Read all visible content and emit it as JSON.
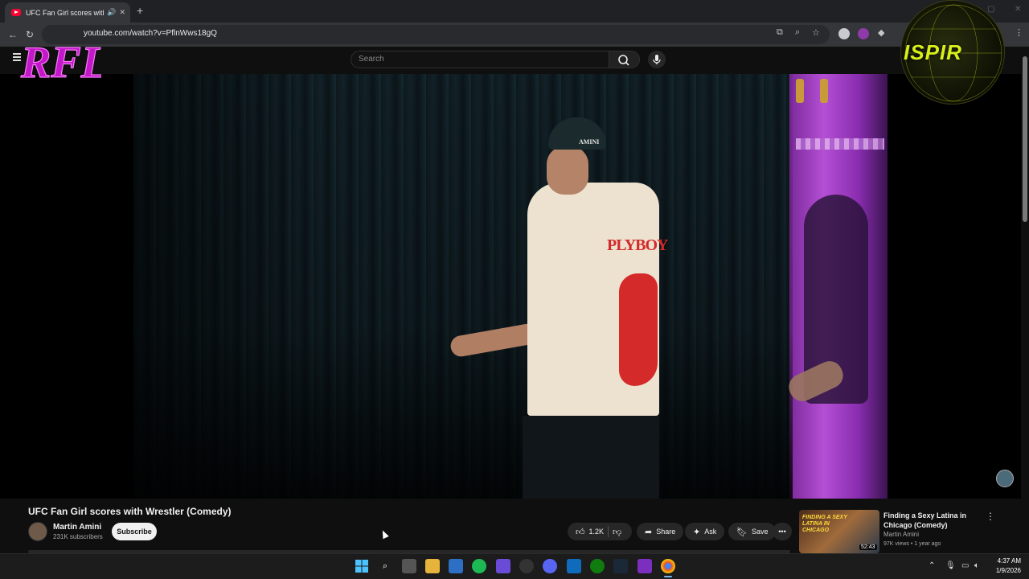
{
  "browser": {
    "tab_title": "UFC Fan Girl scores with Wrestler (Comedy)",
    "tab_audio_icon": "speaker-icon",
    "new_tab_label": "+",
    "url": "youtube.com/watch?v=PflnWws18gQ"
  },
  "youtube": {
    "search_placeholder": "Search",
    "video": {
      "cap_text": "AMINI",
      "shirt_text": "PLYBOY"
    },
    "title": "UFC Fan Girl scores with Wrestler (Comedy)",
    "channel": {
      "name": "Martin Amini",
      "subscribers": "231K subscribers",
      "subscribe_label": "Subscribe"
    },
    "actions": {
      "likes": "1.2K",
      "share": "Share",
      "ask": "Ask",
      "save": "Save"
    },
    "recommendation": {
      "thumb_text": "FINDING A SEXY LATINA IN CHICAGO",
      "duration": "52:43",
      "title": "Finding a Sexy Latina in Chicago (Comedy)",
      "channel": "Martin Amini",
      "meta": "97K views • 1 year ago"
    }
  },
  "overlay": {
    "left_logo_text": "RFL",
    "right_logo_text": "ISPIR"
  },
  "taskbar": {
    "time": "4:37 AM",
    "date": "1/9/2026"
  },
  "colors": {
    "youtube_red": "#ff0033",
    "page_bg": "#0f0f0f",
    "logo_right": "#d8ef1a",
    "logo_left": "#c218c8"
  }
}
